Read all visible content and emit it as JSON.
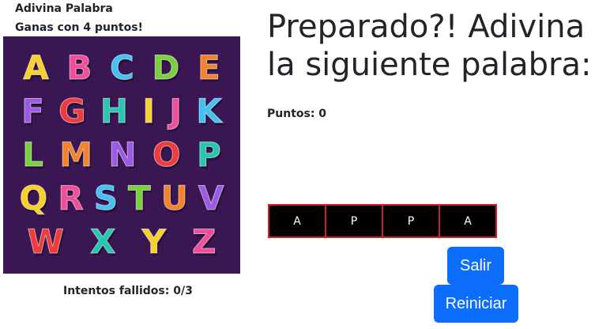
{
  "game": {
    "title": "Adivina Palabra",
    "win_condition": "Ganas con 4 puntos!",
    "heading": "Preparado?! Adivina la siguiente palabra:",
    "score_text": "Puntos: 0",
    "failed_attempts_text": "Intentos fallidos: 0/3",
    "word_letters": [
      "A",
      "P",
      "P",
      "A"
    ],
    "exit_label": "Salir",
    "restart_label": "Reiniciar"
  },
  "alphabet_image": {
    "background": "#3a1752",
    "rows": [
      [
        "A",
        "B",
        "C",
        "D",
        "E"
      ],
      [
        "F",
        "G",
        "H",
        "I",
        "J",
        "K"
      ],
      [
        "L",
        "M",
        "N",
        "O",
        "P"
      ],
      [
        "Q",
        "R",
        "S",
        "T",
        "U",
        "V"
      ],
      [
        "W",
        "X",
        "Y",
        "Z"
      ]
    ],
    "letter_colors": [
      "#f7d02c",
      "#f04e98",
      "#43c1f2",
      "#7ad03a",
      "#f2822b",
      "#9b59e6",
      "#ee3b3b",
      "#26c6b0"
    ]
  },
  "colors": {
    "button": "#0d6efd",
    "tile_background": "#000000",
    "tile_border": "#d21f1f"
  }
}
